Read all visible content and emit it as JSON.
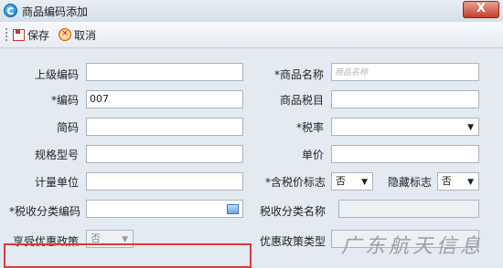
{
  "window": {
    "title": "商品编码添加",
    "close_label": "X"
  },
  "toolbar": {
    "save_label": "保存",
    "cancel_label": "取消"
  },
  "form": {
    "parent_code": {
      "label": "上级编码",
      "value": ""
    },
    "code": {
      "label": "*编码",
      "value": "007"
    },
    "short_code": {
      "label": "简码",
      "value": ""
    },
    "spec": {
      "label": "规格型号",
      "value": ""
    },
    "unit": {
      "label": "计量单位",
      "value": ""
    },
    "tax_class_code": {
      "label": "*税收分类编码",
      "value": ""
    },
    "preferential_policy": {
      "label": "享受优惠政策",
      "value": "否"
    },
    "product_name": {
      "label": "*商品名称",
      "placeholder": "商品名称",
      "value": ""
    },
    "product_tax_item": {
      "label": "商品税目",
      "value": ""
    },
    "tax_rate": {
      "label": "*税率",
      "value": ""
    },
    "unit_price": {
      "label": "单价",
      "value": ""
    },
    "tax_included_flag": {
      "label": "*含税价标志",
      "value": "否"
    },
    "hidden_flag": {
      "label": "隐藏标志",
      "value": "否"
    },
    "tax_class_name": {
      "label": "税收分类名称",
      "value": ""
    },
    "policy_type": {
      "label": "优惠政策类型",
      "value": ""
    }
  },
  "watermark": "广东航天信息",
  "icons": {
    "app": "app-logo-icon",
    "save": "save-icon",
    "cancel": "cancel-icon",
    "dropdown": "chevron-down-icon",
    "picker": "picker-icon"
  },
  "colors": {
    "highlight": "#d93b3b",
    "close": "#c2412b"
  }
}
